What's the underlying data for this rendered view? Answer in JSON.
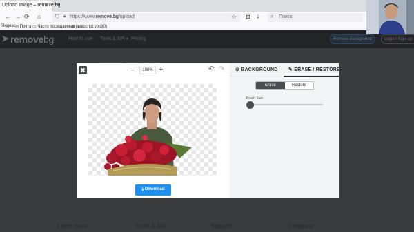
{
  "browser": {
    "tab_title": "Upload Image – remove.bg",
    "tab_close": "×",
    "new_tab": "+",
    "url_host": "remove.bg",
    "url_prefix": "https://www.",
    "url_path": "/upload",
    "search_placeholder": "Поиск",
    "bookmarks": [
      {
        "label": "Яндекс",
        "icon": "yandex-icon"
      },
      {
        "label": "Почта",
        "icon": "mail-icon"
      },
      {
        "label": "Часто посещаемые",
        "icon": "bookmark-folder-icon"
      },
      {
        "label": "javascript:void(0)",
        "icon": "globe-icon"
      }
    ]
  },
  "site": {
    "logo_bold": "remove",
    "logo_light": "bg",
    "nav": [
      {
        "label": "How to use",
        "caret": ""
      },
      {
        "label": "Tools & API",
        "caret": "▾"
      },
      {
        "label": "Pricing",
        "caret": ""
      }
    ],
    "remove_background_button": "Remove Background",
    "login_button": "Login / Sign up",
    "page_heading": "Remove Background",
    "footer": [
      "Learn more",
      "Tools & API",
      "Support",
      "Company"
    ]
  },
  "editor": {
    "close": "✖",
    "zoom_minus": "−",
    "zoom_plus": "+",
    "zoom_level": "100%",
    "undo": "↶",
    "redo": "↷",
    "download_label": "⤓ Download",
    "tab_background": "BACKGROUND",
    "tab_erase_restore": "ERASE / RESTORE",
    "erase_label": "Erase",
    "restore_label": "Restore",
    "brush_size_label": "Brush Size",
    "brush_size_fraction": 0.0,
    "accent_color": "#1f8ff0"
  }
}
